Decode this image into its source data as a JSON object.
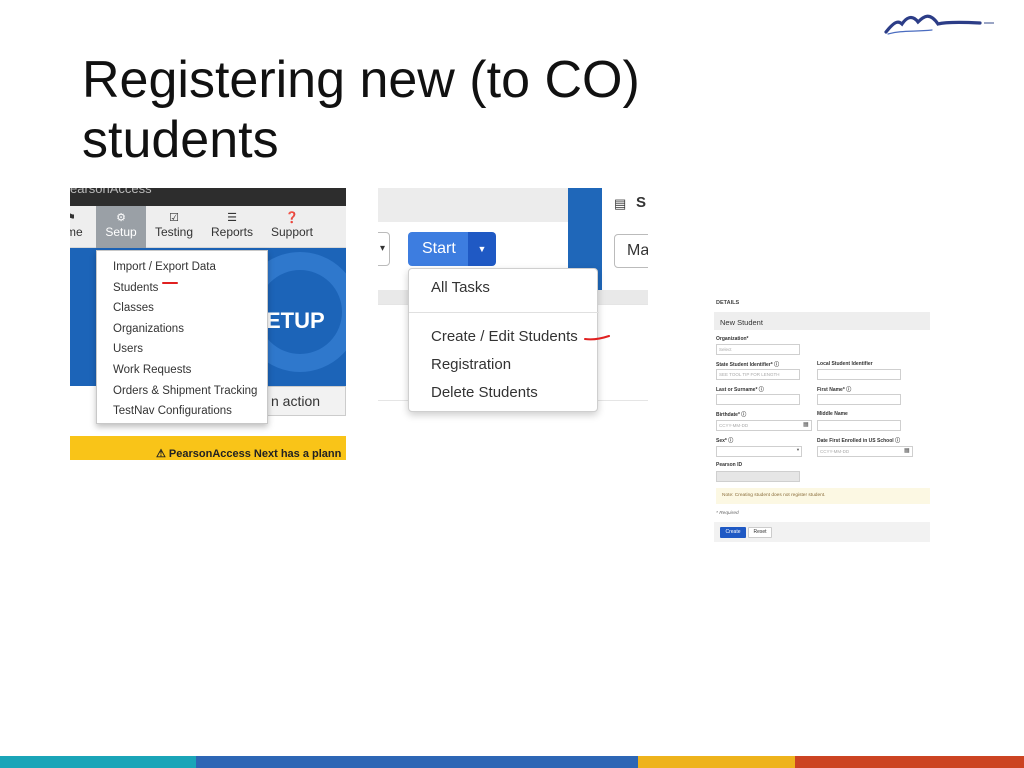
{
  "slide": {
    "title_line1": "Registering new (to CO)",
    "title_line2": "students"
  },
  "colors": {
    "band": [
      "#1aa5b8",
      "#2d66b5",
      "#eeb31c",
      "#cc4422"
    ],
    "logo": "#2c3d87",
    "pearson_blue": "#1f67b9",
    "primary_button": "#3d7de0",
    "annotation_red": "#e02020"
  },
  "screenshot1": {
    "topbar_text": "earsonAccess",
    "nav": [
      {
        "label": "me",
        "icon": "home-icon"
      },
      {
        "label": "Setup",
        "icon": "gear-icon"
      },
      {
        "label": "Testing",
        "icon": "checkbox-icon"
      },
      {
        "label": "Reports",
        "icon": "list-icon"
      },
      {
        "label": "Support",
        "icon": "question-icon"
      }
    ],
    "setup_menu": [
      "Import / Export Data",
      "Students",
      "Classes",
      "Organizations",
      "Users",
      "Work Requests",
      "Orders & Shipment Tracking",
      "TestNav Configurations"
    ],
    "banner_text": "ETUP",
    "action_button": "n action",
    "alert_text": "PearsonAccess Next has a plann"
  },
  "screenshot2": {
    "start_button": "Start",
    "tasks_menu": [
      "All Tasks",
      "Create / Edit Students",
      "Registration",
      "Delete Students"
    ],
    "panel_title": "S",
    "panel_button": "Ma"
  },
  "screenshot3": {
    "section_heading": "DETAILS",
    "form_title": "New Student",
    "fields": {
      "organization_label": "Organization*",
      "organization_placeholder": "Select",
      "ssid_label": "State Student Identifier*",
      "ssid_placeholder": "SEE TOOL TIP FOR LENGTH",
      "local_id_label": "Local Student Identifier",
      "last_name_label": "Last or Surname*",
      "first_name_label": "First Name*",
      "birthdate_label": "Birthdate*",
      "birthdate_placeholder": "CCYY-MM-DD",
      "middle_name_label": "Middle Name",
      "sex_label": "Sex*",
      "first_enrolled_label": "Date First Enrolled in US School",
      "first_enrolled_placeholder": "CCYY-MM-DD",
      "pearson_id_label": "Pearson ID"
    },
    "note": "Note: Creating student does not register student.",
    "required_note": "* Required",
    "create_button": "Create",
    "reset_button": "Reset"
  }
}
